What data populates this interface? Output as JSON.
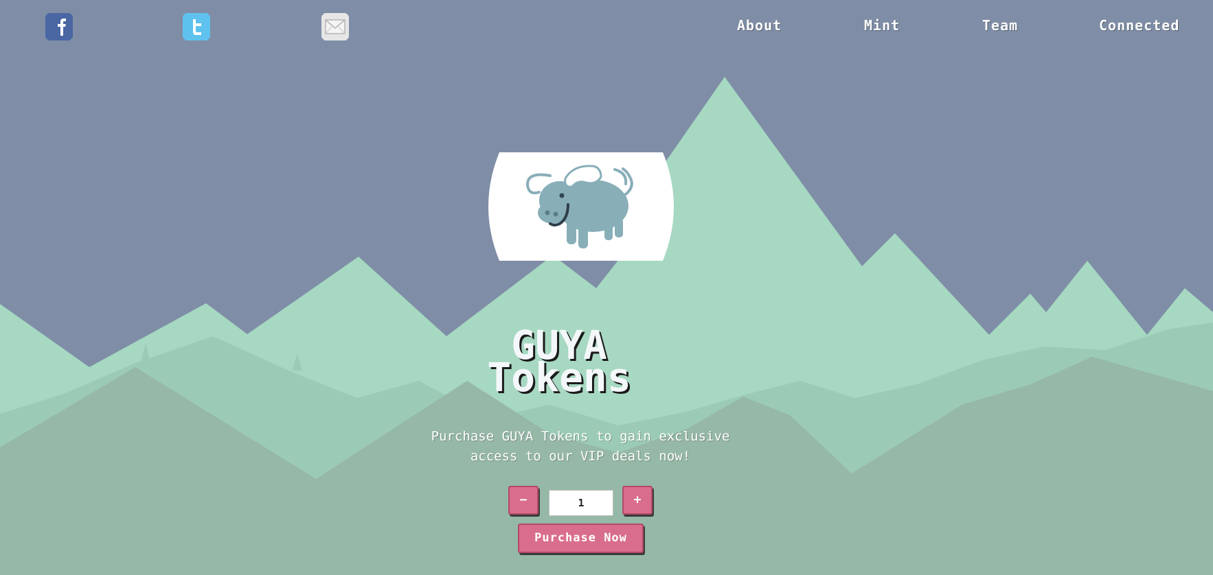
{
  "social": {
    "facebook_icon": "facebook-icon",
    "twitter_icon": "twitter-icon",
    "email_icon": "mail-icon"
  },
  "nav": {
    "about": "About",
    "mint": "Mint",
    "team": "Team",
    "connected": "Connected"
  },
  "hero": {
    "logo_icon": "buffalo-icon",
    "title_line1": "GUYA",
    "title_line2": "Tokens",
    "subtitle_line1": "Purchase GUYA Tokens to gain exclusive",
    "subtitle_line2": "access to our VIP deals now!"
  },
  "mint": {
    "decrement_label": "−",
    "increment_label": "+",
    "quantity": "1",
    "purchase_label": "Purchase Now"
  },
  "colors": {
    "sky": "#7f8ea6",
    "mountain_light": "#a6d8c2",
    "mountain_mid": "#9ccbb5",
    "mountain_dark": "#96b8a7",
    "button": "#d96e8c",
    "text": "#ffffff"
  }
}
